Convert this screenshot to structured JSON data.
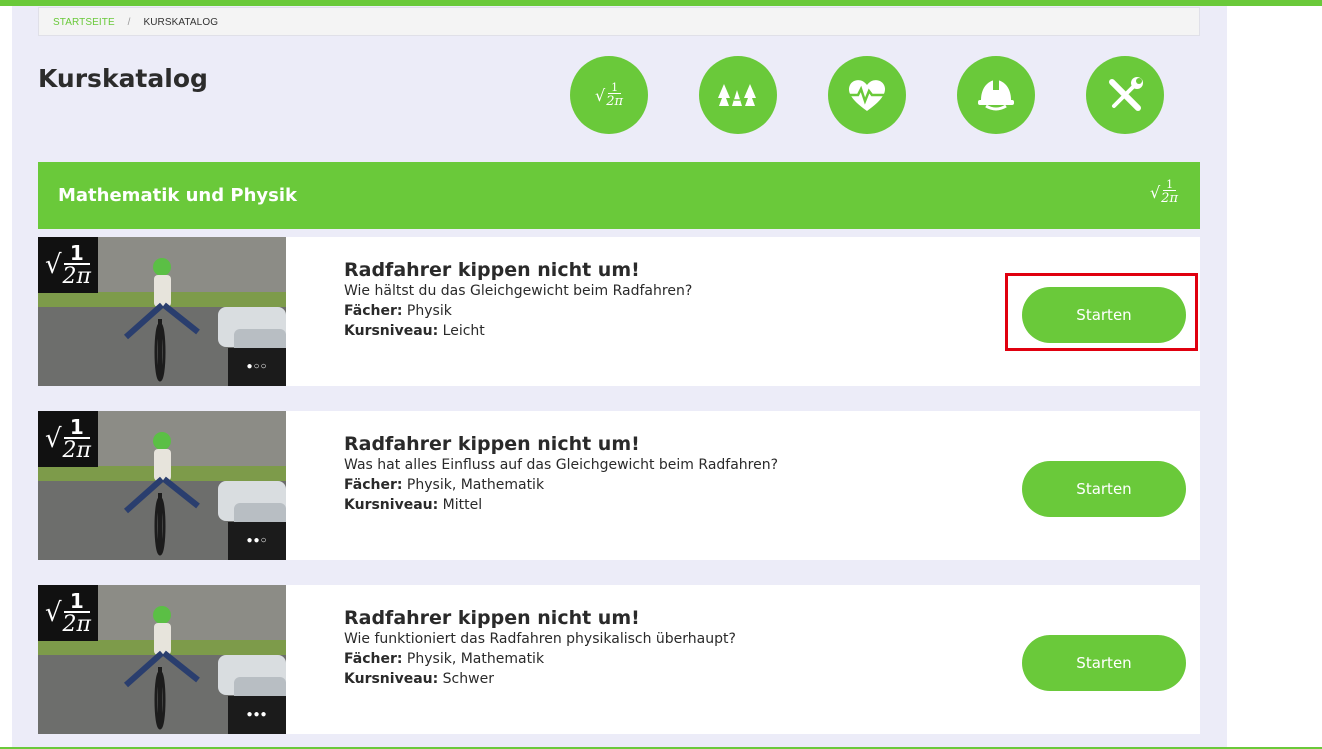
{
  "breadcrumb": {
    "home": "STARTSEITE",
    "separator": "/",
    "current": "KURSKATALOG"
  },
  "page_title": "Kurskatalog",
  "category_icons": [
    {
      "name": "math-physics-icon",
      "glyph": "fraction"
    },
    {
      "name": "nature-icon",
      "glyph": "trees"
    },
    {
      "name": "health-icon",
      "glyph": "heartbeat"
    },
    {
      "name": "safety-icon",
      "glyph": "helmet"
    },
    {
      "name": "tools-icon",
      "glyph": "wrench-screwdriver"
    }
  ],
  "fraction": {
    "num": "1",
    "den": "2π",
    "root": "√"
  },
  "section": {
    "title": "Mathematik und Physik"
  },
  "labels": {
    "subjects": "Fächer:",
    "level": "Kursniveau:"
  },
  "courses": [
    {
      "title": "Radfahrer kippen nicht um!",
      "description": "Wie hältst du das Gleichgewicht beim Radfahren?",
      "subjects": "Physik",
      "level": "Leicht",
      "dots": "●○○",
      "button": "Starten"
    },
    {
      "title": "Radfahrer kippen nicht um!",
      "description": "Was hat alles Einfluss auf das Gleichgewicht beim Radfahren?",
      "subjects": "Physik, Mathematik",
      "level": "Mittel",
      "dots": "●●○",
      "button": "Starten"
    },
    {
      "title": "Radfahrer kippen nicht um!",
      "description": "Wie funktioniert das Radfahren physikalisch überhaupt?",
      "subjects": "Physik, Mathematik",
      "level": "Schwer",
      "dots": "●●●",
      "button": "Starten"
    }
  ],
  "colors": {
    "accent": "#6ac93a",
    "highlight": "#e0000f",
    "panel": "#ececf8"
  }
}
